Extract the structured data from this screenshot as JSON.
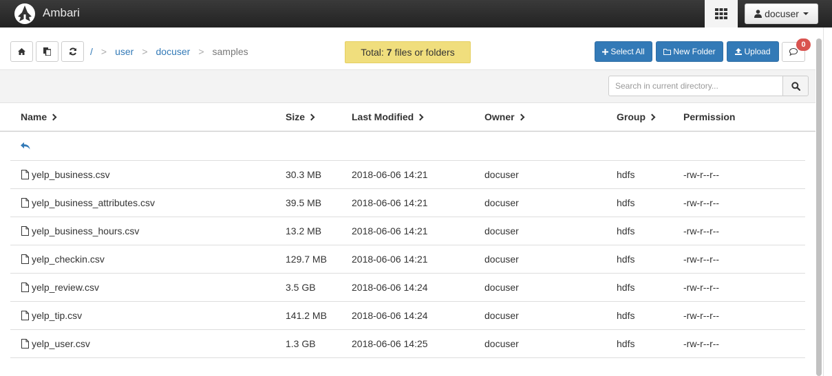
{
  "app": {
    "title": "Ambari"
  },
  "header": {
    "user_label": "docuser",
    "apps_icon": "grid-icon",
    "user_icon": "user-icon"
  },
  "toolbar": {
    "home_icon": "home-icon",
    "copy_icon": "copy-icon",
    "refresh_icon": "refresh-icon",
    "select_all_label": "Select All",
    "new_folder_label": "New Folder",
    "upload_label": "Upload",
    "notification_count": "0"
  },
  "breadcrumb": {
    "root": "/",
    "separator": ">",
    "items": [
      "user",
      "docuser"
    ],
    "current": "samples"
  },
  "total": {
    "prefix": "Total:",
    "count": "7",
    "suffix": "files or folders"
  },
  "search": {
    "placeholder": "Search in current directory..."
  },
  "table": {
    "columns": [
      "Name",
      "Size",
      "Last Modified",
      "Owner",
      "Group",
      "Permission"
    ],
    "rows": [
      {
        "name": "yelp_business.csv",
        "size": "30.3 MB",
        "modified": "2018-06-06 14:21",
        "owner": "docuser",
        "group": "hdfs",
        "permission": "-rw-r--r--"
      },
      {
        "name": "yelp_business_attributes.csv",
        "size": "39.5 MB",
        "modified": "2018-06-06 14:21",
        "owner": "docuser",
        "group": "hdfs",
        "permission": "-rw-r--r--"
      },
      {
        "name": "yelp_business_hours.csv",
        "size": "13.2 MB",
        "modified": "2018-06-06 14:21",
        "owner": "docuser",
        "group": "hdfs",
        "permission": "-rw-r--r--"
      },
      {
        "name": "yelp_checkin.csv",
        "size": "129.7 MB",
        "modified": "2018-06-06 14:21",
        "owner": "docuser",
        "group": "hdfs",
        "permission": "-rw-r--r--"
      },
      {
        "name": "yelp_review.csv",
        "size": "3.5 GB",
        "modified": "2018-06-06 14:24",
        "owner": "docuser",
        "group": "hdfs",
        "permission": "-rw-r--r--"
      },
      {
        "name": "yelp_tip.csv",
        "size": "141.2 MB",
        "modified": "2018-06-06 14:24",
        "owner": "docuser",
        "group": "hdfs",
        "permission": "-rw-r--r--"
      },
      {
        "name": "yelp_user.csv",
        "size": "1.3 GB",
        "modified": "2018-06-06 14:25",
        "owner": "docuser",
        "group": "hdfs",
        "permission": "-rw-r--r--"
      }
    ]
  },
  "colors": {
    "primary": "#337ab7",
    "total_bg": "#f0de7d",
    "badge": "#d9534f",
    "topbar": "#2b2b2b"
  }
}
